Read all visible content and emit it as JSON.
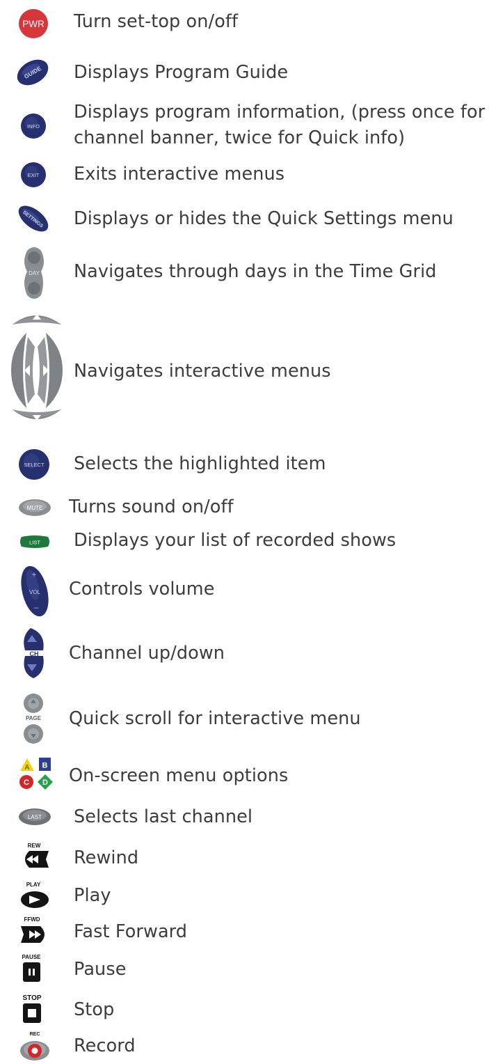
{
  "items": [
    {
      "icon": "power-button-icon",
      "icon_label": "PWR",
      "text": "Turn set-top on/off"
    },
    {
      "icon": "guide-button-icon",
      "icon_label": "GUIDE",
      "text": "Displays Program Guide"
    },
    {
      "icon": "info-button-icon",
      "icon_label": "INFO",
      "text": "Displays program information, (press once for channel banner, twice for Quick info)"
    },
    {
      "icon": "exit-button-icon",
      "icon_label": "EXIT",
      "text": "Exits interactive menus"
    },
    {
      "icon": "settings-button-icon",
      "icon_label": "SETTINGS",
      "text": "Displays or hides the Quick Settings menu"
    },
    {
      "icon": "day-rocker-icon",
      "icon_label": "DAY",
      "text": "Navigates through days in the Time Grid"
    },
    {
      "icon": "arrow-pad-icon",
      "text": "Navigates interactive menus"
    },
    {
      "icon": "select-button-icon",
      "icon_label": "SELECT",
      "text": "Selects the highlighted item"
    },
    {
      "icon": "mute-button-icon",
      "icon_label": "MUTE",
      "text": "Turns sound on/off"
    },
    {
      "icon": "list-button-icon",
      "icon_label": "LIST",
      "text": "Displays your list of recorded shows"
    },
    {
      "icon": "volume-rocker-icon",
      "icon_label": "VOL",
      "text": "Controls volume"
    },
    {
      "icon": "channel-rocker-icon",
      "icon_label": "CH",
      "text": "Channel up/down"
    },
    {
      "icon": "page-rocker-icon",
      "icon_label": "PAGE",
      "text": "Quick scroll for interactive menu"
    },
    {
      "icon": "abcd-buttons-icon",
      "icon_label": "A B C D",
      "text": "On-screen menu options"
    },
    {
      "icon": "last-button-icon",
      "icon_label": "LAST",
      "text": "Selects last channel"
    },
    {
      "icon": "rewind-button-icon",
      "icon_label": "REW",
      "text": "Rewind"
    },
    {
      "icon": "play-button-icon",
      "icon_label": "PLAY",
      "text": "Play"
    },
    {
      "icon": "fast-forward-button-icon",
      "icon_label": "FFWD",
      "text": "Fast Forward"
    },
    {
      "icon": "pause-button-icon",
      "icon_label": "PAUSE",
      "text": "Pause"
    },
    {
      "icon": "stop-button-icon",
      "icon_label": "STOP",
      "text": "Stop"
    },
    {
      "icon": "record-button-icon",
      "icon_label": "REC",
      "text": "Record"
    }
  ],
  "colors": {
    "text": "#3c3c3c",
    "power_red": "#d7373b",
    "navy": "#27306e",
    "navy_light": "#3c4890",
    "gray": "#8a8d92",
    "gray_dark": "#5b5e63",
    "list_green": "#1d7a3d",
    "yellow": "#f2d314",
    "blue_b": "#2f3f8f",
    "red_c": "#d3262a",
    "green_d": "#25a249",
    "black": "#141414"
  }
}
